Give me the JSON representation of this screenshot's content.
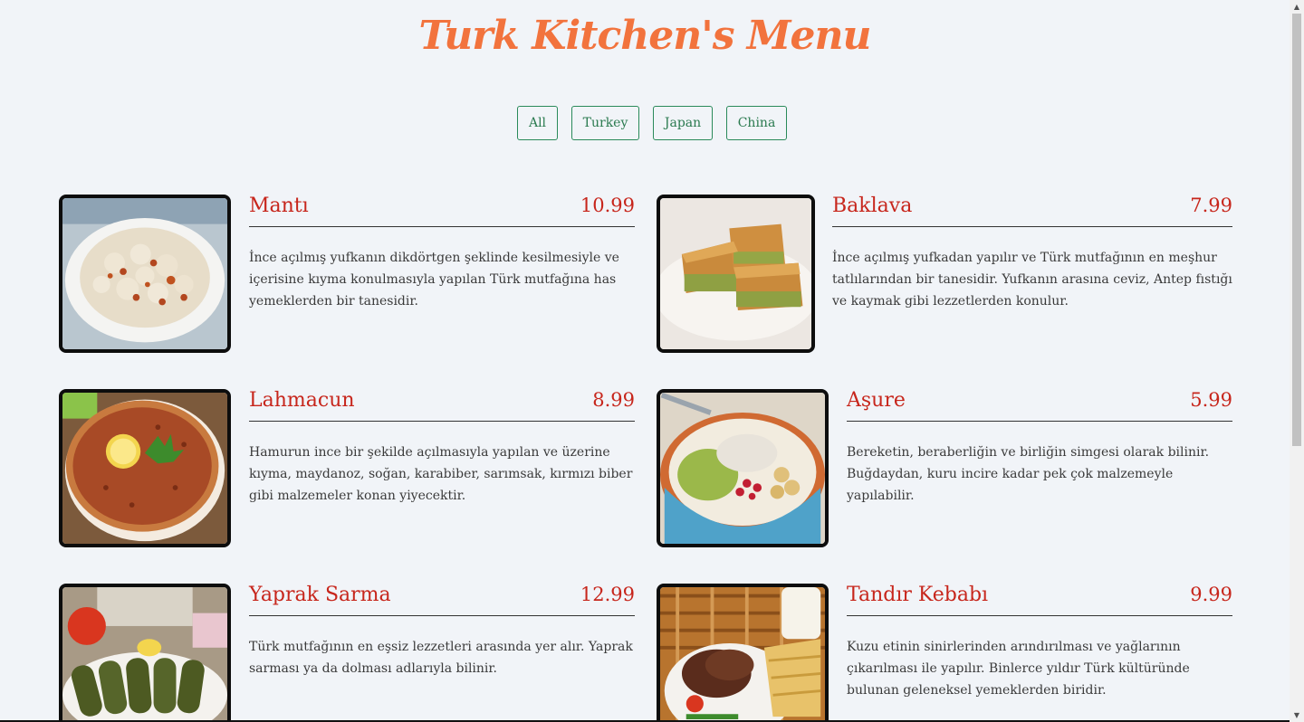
{
  "title": "Turk Kitchen's Menu",
  "filters": [
    "All",
    "Turkey",
    "Japan",
    "China"
  ],
  "items": [
    {
      "name": "Mantı",
      "price": "10.99",
      "desc": "İnce açılmış yufkanın dikdörtgen şeklinde kesilmesiyle ve içerisine kıyma konulmasıyla yapılan Türk mutfağına has yemeklerden bir tanesidir."
    },
    {
      "name": "Baklava",
      "price": "7.99",
      "desc": "İnce açılmış yufkadan yapılır ve Türk mutfağının en meşhur tatlılarından bir tanesidir. Yufkanın arasına ceviz, Antep fıstığı ve kaymak gibi lezzetlerden konulur."
    },
    {
      "name": "Lahmacun",
      "price": "8.99",
      "desc": "Hamurun ince bir şekilde açılmasıyla yapılan ve üzerine kıyma, maydanoz, soğan, karabiber, sarımsak, kırmızı biber gibi malzemeler konan yiyecektir."
    },
    {
      "name": "Aşure",
      "price": "5.99",
      "desc": "Bereketin, beraberliğin ve birliğin simgesi olarak bilinir. Buğdaydan, kuru incire kadar pek çok malzemeyle yapılabilir."
    },
    {
      "name": "Yaprak Sarma",
      "price": "12.99",
      "desc": "Türk mutfağının en eşsiz lezzetleri arasında yer alır. Yaprak sarması ya da dolması adlarıyla bilinir."
    },
    {
      "name": "Tandır Kebabı",
      "price": "9.99",
      "desc": "Kuzu etinin sinirlerinden arındırılması ve yağlarının çıkarılması ile yapılır. Binlerce yıldır Türk kültüründe bulunan geleneksel yemeklerden biridir."
    }
  ]
}
